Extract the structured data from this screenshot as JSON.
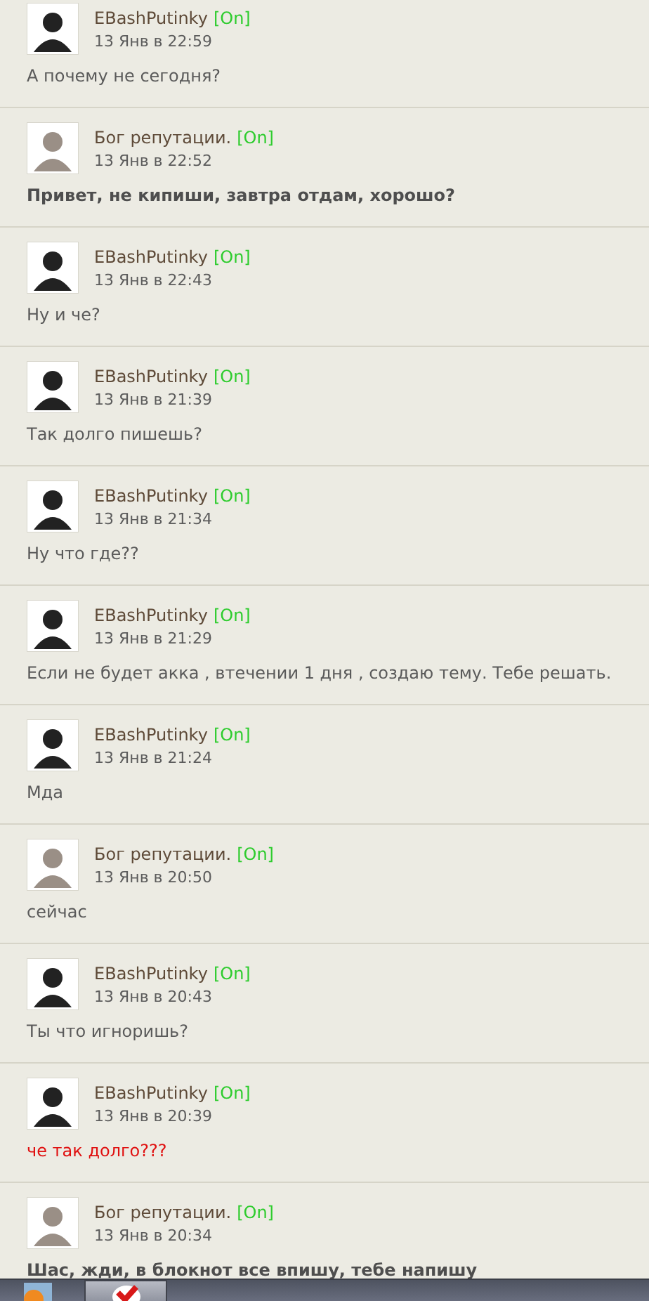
{
  "messages": [
    {
      "author": "EBashPutinky",
      "avatar": {
        "kind": "dark"
      },
      "status": "[On]",
      "time": "13 Янв в 22:59",
      "text": "А почему не сегодня?",
      "kind": "plain"
    },
    {
      "author": "Бог репутации.",
      "avatar": {
        "kind": "light"
      },
      "status": "[On]",
      "time": "13 Янв в 22:52",
      "text": "Привет, не кипиши, завтра отдам, хорошо?",
      "kind": "bold"
    },
    {
      "author": "EBashPutinky",
      "avatar": {
        "kind": "dark"
      },
      "status": "[On]",
      "time": "13 Янв в 22:43",
      "text": "Ну и че?",
      "kind": "plain"
    },
    {
      "author": "EBashPutinky",
      "avatar": {
        "kind": "dark"
      },
      "status": "[On]",
      "time": "13 Янв в 21:39",
      "text": "Так долго пишешь?",
      "kind": "plain"
    },
    {
      "author": "EBashPutinky",
      "avatar": {
        "kind": "dark"
      },
      "status": "[On]",
      "time": "13 Янв в 21:34",
      "text": "Ну что где??",
      "kind": "plain"
    },
    {
      "author": "EBashPutinky",
      "avatar": {
        "kind": "dark"
      },
      "status": "[On]",
      "time": "13 Янв в 21:29",
      "text": "Если не будет акка , втечении 1 дня , создаю тему. Тебе решать.",
      "kind": "plain"
    },
    {
      "author": "EBashPutinky",
      "avatar": {
        "kind": "dark"
      },
      "status": "[On]",
      "time": "13 Янв в 21:24",
      "text": "Мда",
      "kind": "plain"
    },
    {
      "author": "Бог репутации.",
      "avatar": {
        "kind": "light"
      },
      "status": "[On]",
      "time": "13 Янв в 20:50",
      "text": "сейчас",
      "kind": "plain"
    },
    {
      "author": "EBashPutinky",
      "avatar": {
        "kind": "dark"
      },
      "status": "[On]",
      "time": "13 Янв в 20:43",
      "text": "Ты что игноришь?",
      "kind": "plain"
    },
    {
      "author": "EBashPutinky",
      "avatar": {
        "kind": "dark"
      },
      "status": "[On]",
      "time": "13 Янв в 20:39",
      "text": "че так долго???",
      "kind": "red"
    },
    {
      "author": "Бог репутации.",
      "avatar": {
        "kind": "light"
      },
      "status": "[On]",
      "time": "13 Янв в 20:34",
      "text": "Шас, жди, в блокнот все впишу, тебе напишу",
      "kind": "bold"
    }
  ]
}
